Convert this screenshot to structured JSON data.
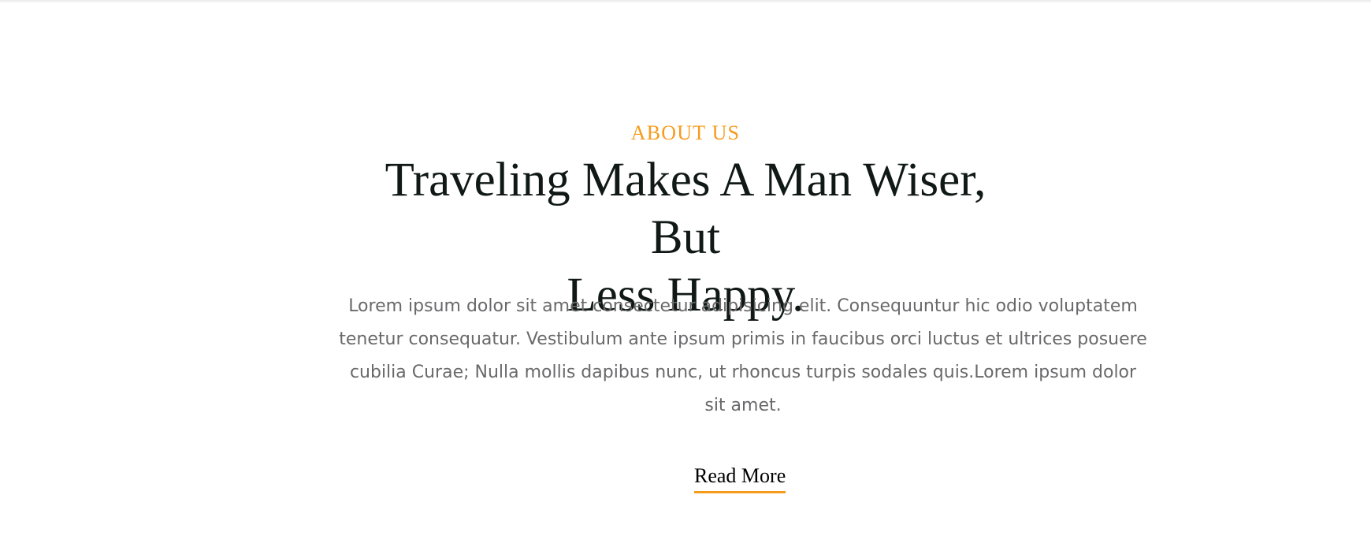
{
  "about": {
    "eyebrow": "ABOUT US",
    "headline_line_1": "Traveling Makes A Man Wiser, But",
    "headline_line_2": "Less Happy.",
    "body": "Lorem ipsum dolor sit amet consectetur adipisicing elit. Consequuntur hic odio voluptatem tenetur consequatur. Vestibulum ante ipsum primis in faucibus orci luctus et ultrices posuere cubilia Curae; Nulla mollis dapibus nunc, ut rhoncus turpis sodales quis.Lorem ipsum dolor sit amet.",
    "cta_label": "Read More"
  },
  "colors": {
    "accent": "#f79b1d",
    "heading": "#101915",
    "body_text": "#69696b",
    "background": "#ffffff"
  }
}
